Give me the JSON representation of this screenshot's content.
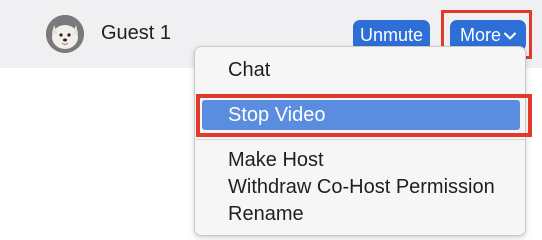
{
  "participant": {
    "name": "Guest 1",
    "avatar_icon": "dog-avatar"
  },
  "actions": {
    "unmute_label": "Unmute",
    "more_label": "More",
    "more_icon": "chevron-down-icon"
  },
  "colors": {
    "button_blue": "#2d6fd6",
    "selected_blue": "#5a8ddf",
    "highlight_red": "#e23a2a"
  },
  "menu": {
    "items": [
      {
        "label": "Chat"
      },
      {
        "label": "Stop Video",
        "selected": true
      },
      {
        "label": "Make Host"
      },
      {
        "label": "Withdraw Co-Host Permission"
      },
      {
        "label": "Rename"
      }
    ]
  }
}
